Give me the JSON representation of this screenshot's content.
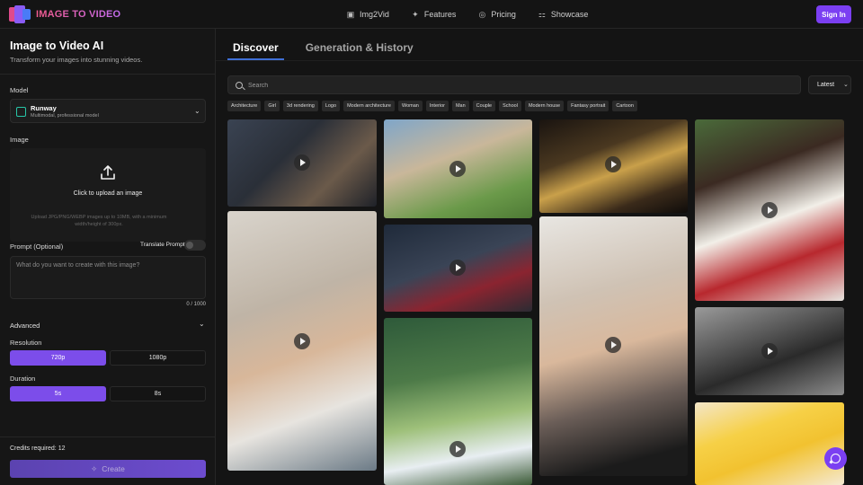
{
  "brand": {
    "name": "IMAGE TO VIDEO"
  },
  "nav": {
    "links": [
      {
        "label": "Img2Vid",
        "icon": "image-icon"
      },
      {
        "label": "Features",
        "icon": "sparkles-icon"
      },
      {
        "label": "Pricing",
        "icon": "coin-icon"
      },
      {
        "label": "Showcase",
        "icon": "grid-icon"
      }
    ],
    "signin_label": "Sign In"
  },
  "sidebar": {
    "title": "Image to Video AI",
    "subtitle": "Transform your images into stunning videos.",
    "model_label": "Model",
    "model": {
      "name": "Runway",
      "description": "Multimodal, professional model"
    },
    "image_label": "Image",
    "upload_text": "Click to upload an image",
    "upload_hint": "Upload JPG/PNG/WEBP images up to 10MB, with a minimum width/height of 300px.",
    "prompt_label": "Prompt (Optional)",
    "translate_label": "Translate Prompt",
    "prompt_placeholder": "What do you want to create with this image?",
    "prompt_counter": "0 / 1000",
    "advanced_label": "Advanced",
    "resolution_label": "Resolution",
    "resolutions": [
      {
        "label": "720p",
        "selected": true
      },
      {
        "label": "1080p",
        "selected": false
      }
    ],
    "duration_label": "Duration",
    "durations": [
      {
        "label": "5s",
        "selected": true
      },
      {
        "label": "8s",
        "selected": false
      }
    ],
    "credits_text": "Credits required: 12",
    "create_label": "Create"
  },
  "main": {
    "tabs": [
      {
        "label": "Discover",
        "active": true
      },
      {
        "label": "Generation & History",
        "active": false
      }
    ],
    "search_placeholder": "Search",
    "sort_value": "Latest",
    "tags": [
      "Architecture",
      "Girl",
      "3d rendering",
      "Logo",
      "Modern architecture",
      "Woman",
      "Interior",
      "Man",
      "Couple",
      "School",
      "Modern house",
      "Fantasy portrait",
      "Cartoon"
    ],
    "gallery": [
      {
        "name": "video-thumb-boy-reading"
      },
      {
        "name": "video-thumb-winged-cartoon-boy"
      },
      {
        "name": "video-thumb-zombie-theater"
      },
      {
        "name": "video-thumb-couple-portrait"
      },
      {
        "name": "video-thumb-blonde-woman-tanktop"
      },
      {
        "name": "video-thumb-woman-bathtub"
      },
      {
        "name": "video-thumb-blonde-woman-black-top"
      },
      {
        "name": "video-thumb-vintage-couple-bw"
      },
      {
        "name": "video-thumb-white-cartoon-cat"
      },
      {
        "name": "video-thumb-cartoon-princess"
      }
    ]
  },
  "colors": {
    "accent": "#7b3ff2",
    "tab_underline": "#3f6fd6",
    "background": "#141414"
  }
}
